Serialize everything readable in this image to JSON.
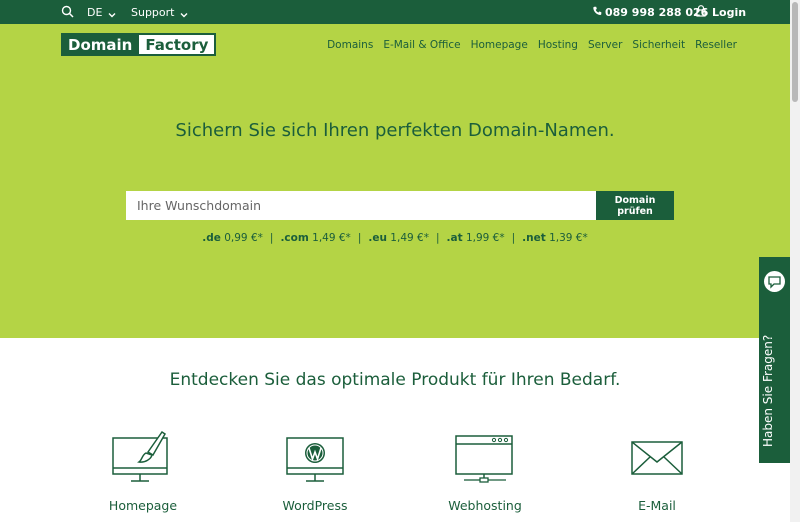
{
  "topbar": {
    "language": "DE",
    "support": "Support",
    "phone": "089 998 288 026",
    "login": "Login",
    "icons": {
      "search": "search-icon",
      "phone": "phone-icon",
      "login": "lock-icon",
      "chevron": "chevron-down-icon"
    }
  },
  "logo": {
    "part1": "Domain",
    "part2": "Factory"
  },
  "nav": [
    {
      "label": "Domains"
    },
    {
      "label": "E-Mail & Office"
    },
    {
      "label": "Homepage"
    },
    {
      "label": "Hosting"
    },
    {
      "label": "Server"
    },
    {
      "label": "Sicherheit"
    },
    {
      "label": "Reseller"
    }
  ],
  "hero": {
    "headline": "Sichern Sie sich Ihren perfekten Domain-Namen.",
    "search_placeholder": "Ihre Wunschdomain",
    "search_button": "Domain prüfen",
    "prices": [
      {
        "tld": ".de",
        "price": "0,99 €*"
      },
      {
        "tld": ".com",
        "price": "1,49 €*"
      },
      {
        "tld": ".eu",
        "price": "1,49 €*"
      },
      {
        "tld": ".at",
        "price": "1,99 €*"
      },
      {
        "tld": ".net",
        "price": "1,39 €*"
      }
    ],
    "separator": "|"
  },
  "products": {
    "title": "Entdecken Sie das optimale Produkt für Ihren Bedarf.",
    "items": [
      {
        "label": "Homepage",
        "icon": "homepage-monitor-brush-icon"
      },
      {
        "label": "WordPress",
        "icon": "wordpress-monitor-icon"
      },
      {
        "label": "Webhosting",
        "icon": "browser-window-icon"
      },
      {
        "label": "E-Mail",
        "icon": "envelope-icon"
      }
    ]
  },
  "side_widget": {
    "label": "Haben Sie Fragen?",
    "icon": "chat-bubble-icon"
  },
  "colors": {
    "dark_green": "#1b5e3b",
    "lime": "#b4d445",
    "white": "#ffffff"
  }
}
